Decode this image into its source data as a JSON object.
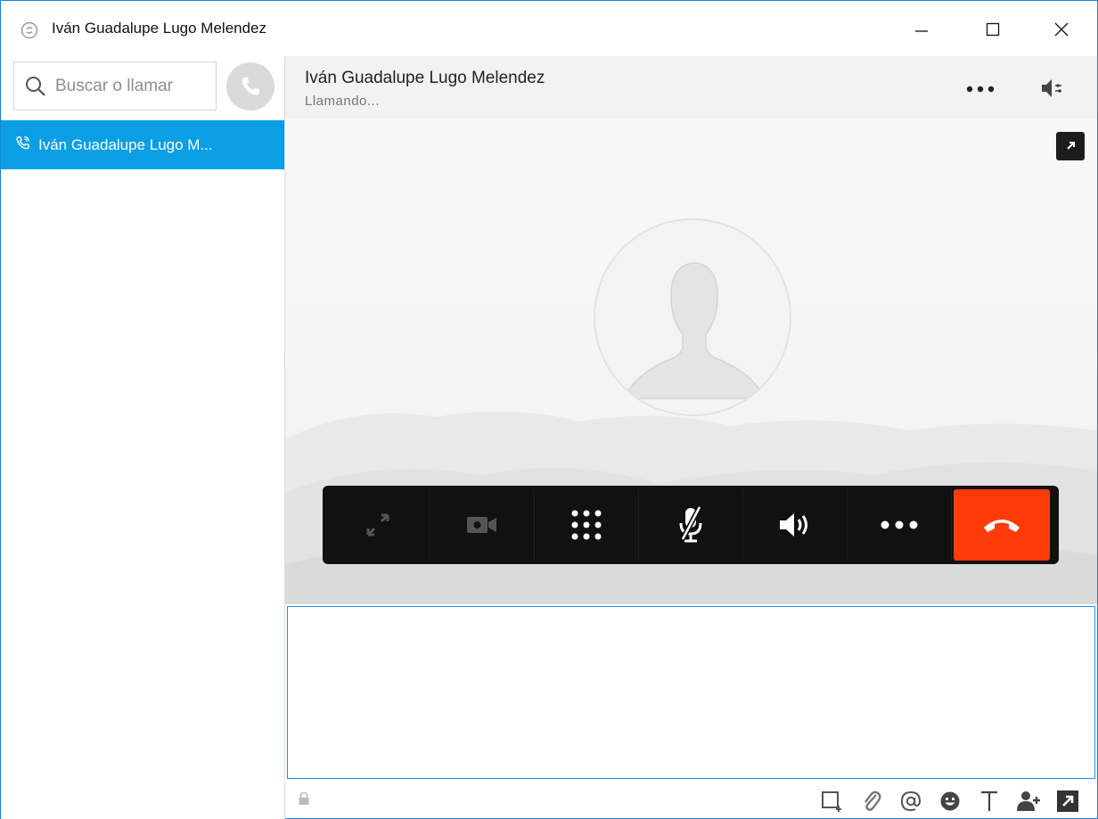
{
  "window": {
    "title": "Iván Guadalupe Lugo Melendez"
  },
  "sidebar": {
    "search_placeholder": "Buscar o llamar",
    "contacts": [
      {
        "label": "Iván Guadalupe Lugo M...",
        "active": true
      }
    ]
  },
  "conversation": {
    "name": "Iván Guadalupe Lugo Melendez",
    "status": "Llamando..."
  },
  "call_controls": [
    {
      "name": "fullscreen",
      "icon": "expand-icon"
    },
    {
      "name": "video",
      "icon": "video-camera-icon"
    },
    {
      "name": "dialpad",
      "icon": "dialpad-icon"
    },
    {
      "name": "mute",
      "icon": "microphone-muted-icon"
    },
    {
      "name": "speaker",
      "icon": "speaker-icon"
    },
    {
      "name": "more",
      "icon": "more-icon"
    },
    {
      "name": "hang-up",
      "icon": "phone-hangup-icon"
    }
  ],
  "colors": {
    "accent": "#0a9ee4",
    "hangup": "#ff3b0a",
    "controls_bg": "#111111"
  }
}
